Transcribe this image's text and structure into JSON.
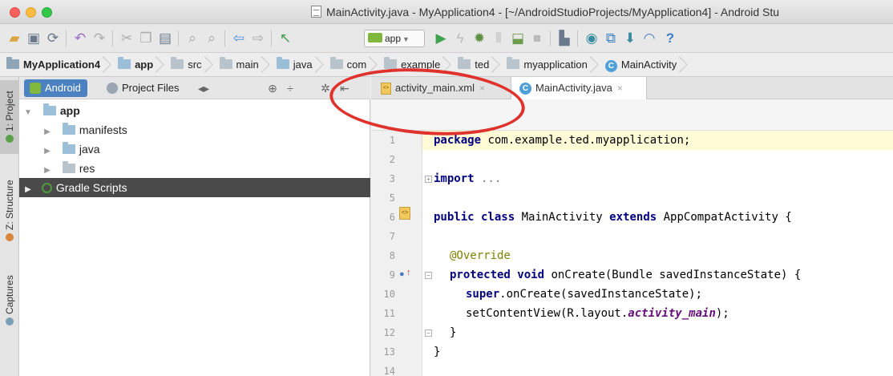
{
  "window": {
    "title": "MainActivity.java - MyApplication4 - [~/AndroidStudioProjects/MyApplication4] - Android Stu"
  },
  "toolbar": {
    "run_config": "app",
    "icons": [
      "open-icon",
      "save-icon",
      "sync-icon",
      "back-icon",
      "forward-icon",
      "cut-icon",
      "copy-icon",
      "paste-icon",
      "find-icon",
      "replace-icon",
      "nav-back-icon",
      "nav-forward-icon",
      "make-icon",
      "run-icon",
      "apply-changes-icon",
      "debug-icon",
      "profile-icon",
      "attach-icon",
      "stop-icon",
      "avd-icon",
      "sdk-icon",
      "gradle-sync-icon",
      "device-monitor-icon",
      "help-icon"
    ]
  },
  "breadcrumb": [
    "MyApplication4",
    "app",
    "src",
    "main",
    "java",
    "com",
    "example",
    "ted",
    "myapplication",
    "MainActivity"
  ],
  "left_strip": {
    "project": "1: Project",
    "structure": "Z: Structure",
    "captures": "Captures"
  },
  "project_panel": {
    "view_android": "Android",
    "view_project_files": "Project Files",
    "tree": [
      {
        "label": "app",
        "level": 0,
        "expanded": true
      },
      {
        "label": "manifests",
        "level": 1
      },
      {
        "label": "java",
        "level": 1
      },
      {
        "label": "res",
        "level": 1
      },
      {
        "label": "Gradle Scripts",
        "level": 0,
        "selected": true
      }
    ]
  },
  "editor": {
    "tabs": [
      {
        "label": "activity_main.xml",
        "active": false
      },
      {
        "label": "MainActivity.java",
        "active": true
      }
    ],
    "line_numbers": [
      "1",
      "2",
      "3",
      "5",
      "6",
      "7",
      "8",
      "9",
      "10",
      "11",
      "12",
      "13",
      "14"
    ],
    "code": {
      "l1_kw": "package",
      "l1_rest": " com.example.ted.myapplication;",
      "l3_kw": "import",
      "l3_rest": " ...",
      "l6_kw1": "public class",
      "l6_mid": " MainActivity ",
      "l6_kw2": "extends",
      "l6_rest": " AppCompatActivity {",
      "l8": "@Override",
      "l9_kw": "protected void",
      "l9_rest": " onCreate(Bundle savedInstanceState) {",
      "l10_kw": "super",
      "l10_rest": ".onCreate(savedInstanceState);",
      "l11_pre": "setContentView(R.layout.",
      "l11_it": "activity_main",
      "l11_post": ");",
      "l12": "}",
      "l13": "}"
    }
  },
  "colors": {
    "selection": "#4a4a4a",
    "active_view": "#4d82c2",
    "annotation_circle": "#e0322c"
  }
}
